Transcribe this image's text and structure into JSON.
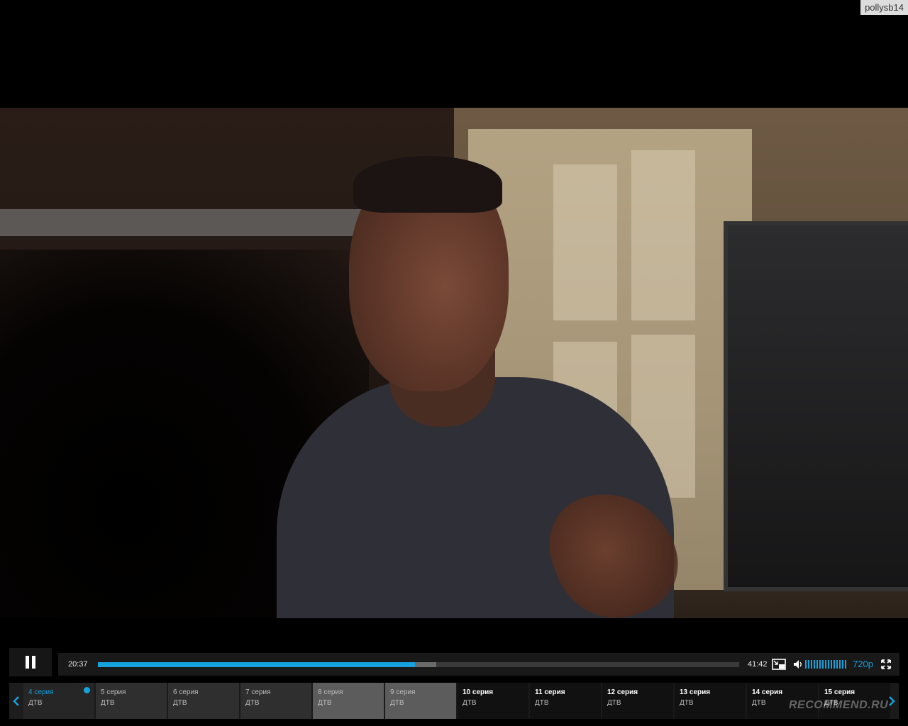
{
  "watermark": {
    "username": "pollysb14",
    "site": "RECOMMEND.RU"
  },
  "player": {
    "current_time": "20:37",
    "total_time": "41:42",
    "progress_fraction": 0.494,
    "buffered_fraction": 0.528,
    "volume_fraction": 1.0,
    "quality": "720p",
    "accent_color": "#16a2dc"
  },
  "episodes": [
    {
      "title": "4 серия",
      "subtitle": "ДТВ",
      "state": "current"
    },
    {
      "title": "5 серия",
      "subtitle": "ДТВ",
      "state": "normal"
    },
    {
      "title": "6 серия",
      "subtitle": "ДТВ",
      "state": "normal"
    },
    {
      "title": "7 серия",
      "subtitle": "ДТВ",
      "state": "normal"
    },
    {
      "title": "8 серия",
      "subtitle": "ДТВ",
      "state": "watched"
    },
    {
      "title": "9 серия",
      "subtitle": "ДТВ",
      "state": "watched"
    },
    {
      "title": "10 серия",
      "subtitle": "ДТВ",
      "state": "upcoming"
    },
    {
      "title": "11 серия",
      "subtitle": "ДТВ",
      "state": "upcoming"
    },
    {
      "title": "12 серия",
      "subtitle": "ДТВ",
      "state": "upcoming"
    },
    {
      "title": "13 серия",
      "subtitle": "ДТВ",
      "state": "upcoming"
    },
    {
      "title": "14 серия",
      "subtitle": "ДТВ",
      "state": "upcoming"
    },
    {
      "title": "15 серия",
      "subtitle": "ДТВ",
      "state": "upcoming"
    }
  ]
}
